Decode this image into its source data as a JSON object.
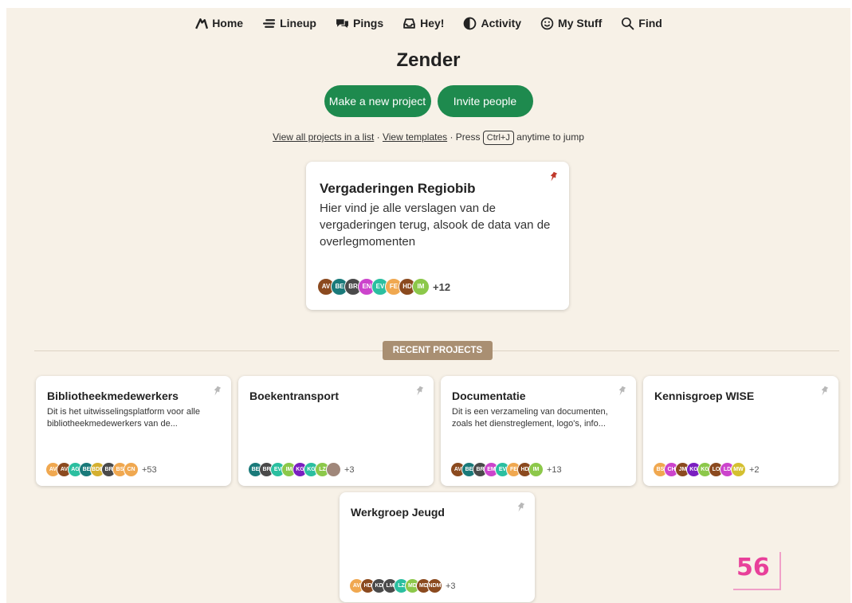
{
  "nav": [
    {
      "label": "Home",
      "icon": "home-icon"
    },
    {
      "label": "Lineup",
      "icon": "lineup-icon"
    },
    {
      "label": "Pings",
      "icon": "pings-icon"
    },
    {
      "label": "Hey!",
      "icon": "hey-icon"
    },
    {
      "label": "Activity",
      "icon": "activity-icon"
    },
    {
      "label": "My Stuff",
      "icon": "smiley-icon"
    },
    {
      "label": "Find",
      "icon": "search-icon"
    }
  ],
  "account_title": "Zender",
  "actions": {
    "new_project": "Make a new project",
    "invite": "Invite people"
  },
  "hint": {
    "view_all": "View all projects in a list",
    "sep1": " · ",
    "templates": "View templates",
    "sep2": " · Press ",
    "shortcut": "Ctrl+J",
    "suffix": " anytime to jump"
  },
  "colors": {
    "accent": "#1e8a4e",
    "background": "#f7f1e7",
    "recent_label_bg": "#a98f72",
    "pin_pinned": "#c0392b",
    "pin_unpinned": "#b8b8b8"
  },
  "featured": {
    "title": "Vergaderingen Regiobib",
    "description": "Hier vind je alle verslagen van de vergaderingen terug, alsook de data van de overlegmomenten",
    "pinned": true,
    "avatars": [
      {
        "i": "AV",
        "c": "#8b4a1f"
      },
      {
        "i": "BE",
        "c": "#1a7a7a"
      },
      {
        "i": "BR",
        "c": "#4a4a4a"
      },
      {
        "i": "EN",
        "c": "#cc44cc"
      },
      {
        "i": "EV",
        "c": "#2bbfa0"
      },
      {
        "i": "FE",
        "c": "#f0a850"
      },
      {
        "i": "HD",
        "c": "#8b4a1f"
      },
      {
        "i": "IM",
        "c": "#8cc84a"
      }
    ],
    "more": "+12"
  },
  "recent_label": "RECENT PROJECTS",
  "projects": [
    {
      "title": "Bibliotheekmedewerkers",
      "description": "Dit is het uitwisselingsplatform voor alle bibliotheekmedewerkers van de...",
      "more": "+53",
      "avatars": [
        {
          "i": "AV",
          "c": "#f0a850"
        },
        {
          "i": "AV",
          "c": "#8b4a1f"
        },
        {
          "i": "AG",
          "c": "#2bbfa0"
        },
        {
          "i": "BE",
          "c": "#1a7a7a"
        },
        {
          "i": "BDB",
          "c": "#d4b030"
        },
        {
          "i": "BR",
          "c": "#4a4a4a"
        },
        {
          "i": "BS",
          "c": "#f0a850"
        },
        {
          "i": "CN",
          "c": "#f0a850"
        }
      ]
    },
    {
      "title": "Boekentransport",
      "description": "",
      "more": "+3",
      "avatars": [
        {
          "i": "BE",
          "c": "#1a7a7a"
        },
        {
          "i": "BR",
          "c": "#4a4a4a"
        },
        {
          "i": "EV",
          "c": "#2bbfa0"
        },
        {
          "i": "IM",
          "c": "#8cc84a"
        },
        {
          "i": "KG",
          "c": "#7a1fc0"
        },
        {
          "i": "KG",
          "c": "#2bbfa0"
        },
        {
          "i": "LZ",
          "c": "#8cc84a"
        },
        {
          "i": "",
          "c": "#a0877a"
        }
      ]
    },
    {
      "title": "Documentatie",
      "description": "Dit is een verzameling van documenten, zoals het dienstreglement, logo's, info...",
      "more": "+13",
      "avatars": [
        {
          "i": "AV",
          "c": "#8b4a1f"
        },
        {
          "i": "BE",
          "c": "#1a7a7a"
        },
        {
          "i": "BR",
          "c": "#4a4a4a"
        },
        {
          "i": "EM",
          "c": "#cc44cc"
        },
        {
          "i": "EV",
          "c": "#2bbfa0"
        },
        {
          "i": "FE",
          "c": "#f0a850"
        },
        {
          "i": "HD",
          "c": "#8b4a1f"
        },
        {
          "i": "IM",
          "c": "#8cc84a"
        }
      ]
    },
    {
      "title": "Kennisgroep WISE",
      "description": "",
      "more": "+2",
      "avatars": [
        {
          "i": "BS",
          "c": "#f0a850"
        },
        {
          "i": "CH",
          "c": "#cc44cc"
        },
        {
          "i": "JM",
          "c": "#8b4a1f"
        },
        {
          "i": "KG",
          "c": "#7a1fc0"
        },
        {
          "i": "KG",
          "c": "#8cc84a"
        },
        {
          "i": "LO",
          "c": "#8b4a1f"
        },
        {
          "i": "LD",
          "c": "#cc44cc"
        },
        {
          "i": "MW",
          "c": "#d4c030"
        }
      ]
    },
    {
      "title": "Werkgroep Jeugd",
      "description": "",
      "more": "+3",
      "avatars": [
        {
          "i": "AV",
          "c": "#f0a850"
        },
        {
          "i": "HD",
          "c": "#8b4a1f"
        },
        {
          "i": "KD",
          "c": "#4a4a4a"
        },
        {
          "i": "LM",
          "c": "#4a4a4a"
        },
        {
          "i": "LZ",
          "c": "#2bbfa0"
        },
        {
          "i": "MD",
          "c": "#8cc84a"
        },
        {
          "i": "MD",
          "c": "#8b4a1f"
        },
        {
          "i": "NDM",
          "c": "#8b4a1f"
        }
      ]
    }
  ],
  "page_badge": "56"
}
